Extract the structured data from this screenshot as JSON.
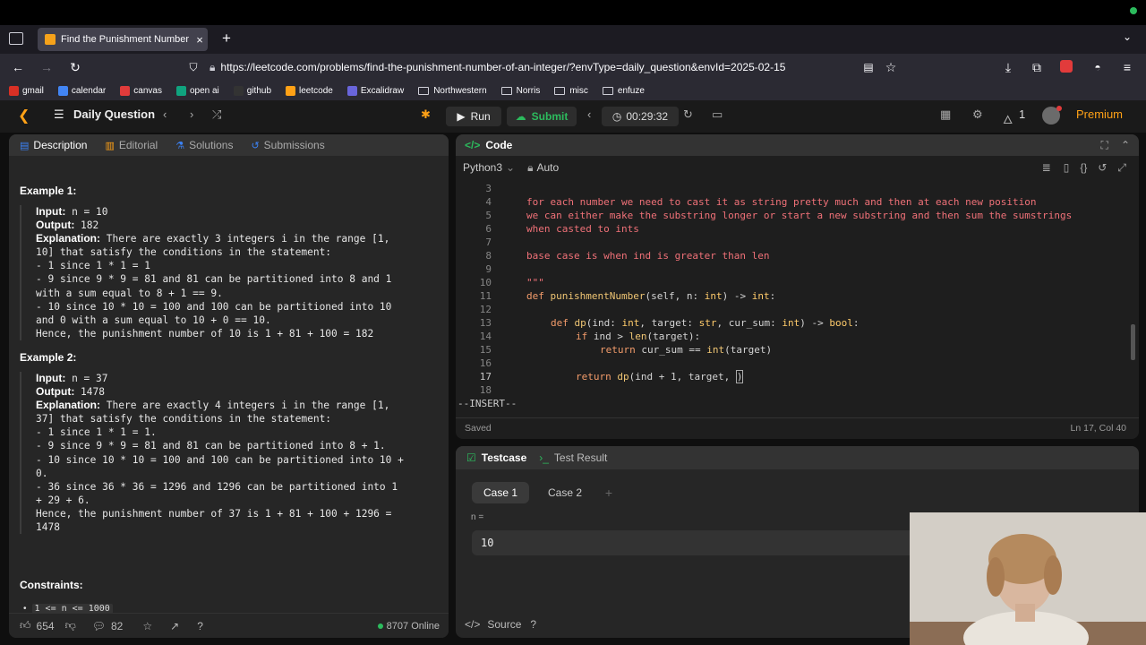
{
  "browser": {
    "tab_title": "Find the Punishment Number of",
    "new_tab": "+",
    "url": "https://leetcode.com/problems/find-the-punishment-number-of-an-integer/?envType=daily_question&envId=2025-02-15",
    "bookmarks": [
      {
        "label": "gmail",
        "color": "#d93025"
      },
      {
        "label": "calendar",
        "color": "#4285f4"
      },
      {
        "label": "canvas",
        "color": "#e03b3b"
      },
      {
        "label": "open ai",
        "color": "#10a37f"
      },
      {
        "label": "github",
        "color": "#333333"
      },
      {
        "label": "leetcode",
        "color": "#ffa116"
      },
      {
        "label": "Excalidraw",
        "color": "#6965db"
      },
      {
        "label": "Northwestern",
        "folder": true
      },
      {
        "label": "Norris",
        "folder": true
      },
      {
        "label": "misc",
        "folder": true
      },
      {
        "label": "enfuze",
        "folder": true
      }
    ]
  },
  "header": {
    "daily_question": "Daily Question",
    "run": "Run",
    "submit": "Submit",
    "timer": "00:29:32",
    "streak": "1",
    "premium": "Premium"
  },
  "left": {
    "tabs": [
      "Description",
      "Editorial",
      "Solutions",
      "Submissions"
    ],
    "example1_title": "Example 1:",
    "example1": {
      "input_label": "Input:",
      "input": " n = 10",
      "output_label": "Output:",
      "output": " 182",
      "expl_label": "Explanation:",
      "expl_first": " There are exactly 3 integers i in the range [1,",
      "lines": [
        "10] that satisfy the conditions in the statement:",
        "- 1 since 1 * 1 = 1",
        "- 9 since 9 * 9 = 81 and 81 can be partitioned into 8 and 1",
        "with a sum equal to 8 + 1 == 9.",
        "- 10 since 10 * 10 = 100 and 100 can be partitioned into 10",
        "and 0 with a sum equal to 10 + 0 == 10.",
        "Hence, the punishment number of 10 is 1 + 81 + 100 = 182"
      ]
    },
    "example2_title": "Example 2:",
    "example2": {
      "input_label": "Input:",
      "input": " n = 37",
      "output_label": "Output:",
      "output": " 1478",
      "expl_label": "Explanation:",
      "expl_first": " There are exactly 4 integers i in the range [1,",
      "lines": [
        "37] that satisfy the conditions in the statement:",
        "- 1 since 1 * 1 = 1.",
        "- 9 since 9 * 9 = 81 and 81 can be partitioned into 8 + 1.",
        "- 10 since 10 * 10 = 100 and 100 can be partitioned into 10 +",
        "0.",
        "- 36 since 36 * 36 = 1296 and 1296 can be partitioned into 1",
        "+ 29 + 6.",
        "Hence, the punishment number of 37 is 1 + 81 + 100 + 1296 =",
        "1478"
      ]
    },
    "constraints_title": "Constraints:",
    "constraint1": "1 <= n <= 1000",
    "likes": "654",
    "comments": "82",
    "online": "8707 Online"
  },
  "code": {
    "title": "Code",
    "language": "Python3",
    "mode": "Auto",
    "insert": "--INSERT--",
    "saved": "Saved",
    "cursor": "Ln 17, Col 40",
    "line_numbers": [
      "3",
      "4",
      "5",
      "6",
      "7",
      "8",
      "9",
      "10",
      "11",
      "12",
      "13",
      "14",
      "15",
      "16",
      "17",
      "18"
    ],
    "lines": {
      "l4": "for each number we need to cast it as string pretty much and then at each new position",
      "l5": "we can either make the substring longer or start a new substring and then sum the sumstrings",
      "l6": "when casted to ints",
      "l8": "base case is when ind is greater than len",
      "l10": "\"\"\"",
      "l11_kw": "def ",
      "l11_fn": "punishmentNumber",
      "l11_a": "(self, n: ",
      "l11_t1": "int",
      "l11_b": ") -> ",
      "l11_t2": "int",
      "l11_c": ":",
      "l13_kw": "def ",
      "l13_fn": "dp",
      "l13_a": "(ind: ",
      "l13_t1": "int",
      "l13_b": ", target: ",
      "l13_t2": "str",
      "l13_c": ", cur_sum: ",
      "l13_t3": "int",
      "l13_d": ") -> ",
      "l13_t4": "bool",
      "l13_e": ":",
      "l14_kw": "if ",
      "l14_a": "ind > ",
      "l14_fn": "len",
      "l14_b": "(target):",
      "l15_kw": "return ",
      "l15_a": "cur_sum == ",
      "l15_fn": "int",
      "l15_b": "(target)",
      "l17_kw": "return ",
      "l17_fn": "dp",
      "l17_a": "(ind + 1, target, ",
      "l17_b": ")"
    }
  },
  "testcase": {
    "tab": "Testcase",
    "result_tab": "Test Result",
    "case1": "Case 1",
    "case2": "Case 2",
    "add": "+",
    "param": "n =",
    "value": "10",
    "source": "Source"
  },
  "colors": {
    "accent": "#ffa116",
    "green": "#2cbb5d",
    "blue": "#3b82f6"
  }
}
